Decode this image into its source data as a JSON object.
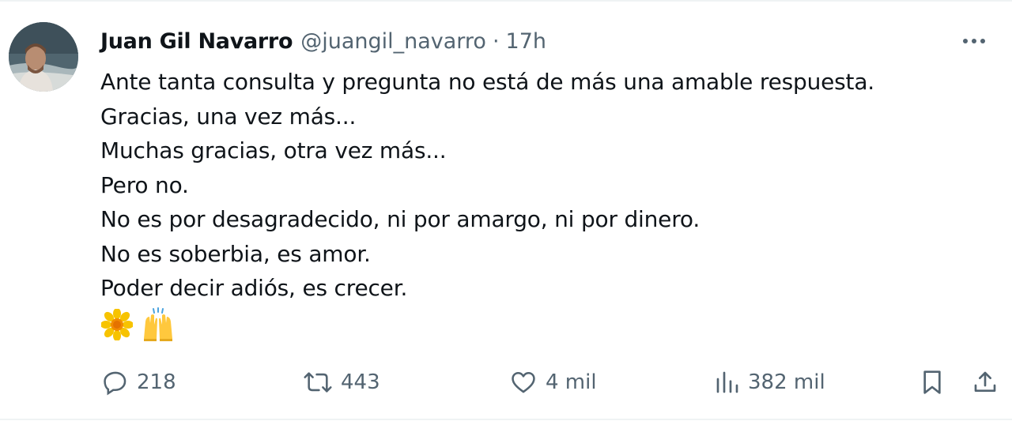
{
  "author": {
    "name": "Juan Gil Navarro",
    "handle": "@juangil_navarro",
    "separator": "·",
    "time": "17h"
  },
  "tweet": {
    "lines": [
      "Ante tanta consulta y pregunta no está de más una amable respuesta.",
      "Gracias, una vez más...",
      "Muchas gracias, otra vez más...",
      "Pero no.",
      "No es por desagradecido, ni por amargo, ni por dinero.",
      "No es soberbia, es amor.",
      "Poder decir adiós, es crecer."
    ],
    "emojis": [
      "sunflower-emoji",
      "raising-hands-emoji"
    ]
  },
  "actions": {
    "replies": "218",
    "reposts": "443",
    "likes": "4 mil",
    "views": "382 mil"
  },
  "icons": {
    "more": "more-horizontal-icon",
    "reply": "reply-icon",
    "repost": "repost-icon",
    "like": "heart-icon",
    "views": "views-chart-icon",
    "bookmark": "bookmark-icon",
    "share": "share-icon"
  },
  "colors": {
    "text_primary": "#0f1419",
    "text_secondary": "#536471",
    "border": "#eff3f4"
  }
}
